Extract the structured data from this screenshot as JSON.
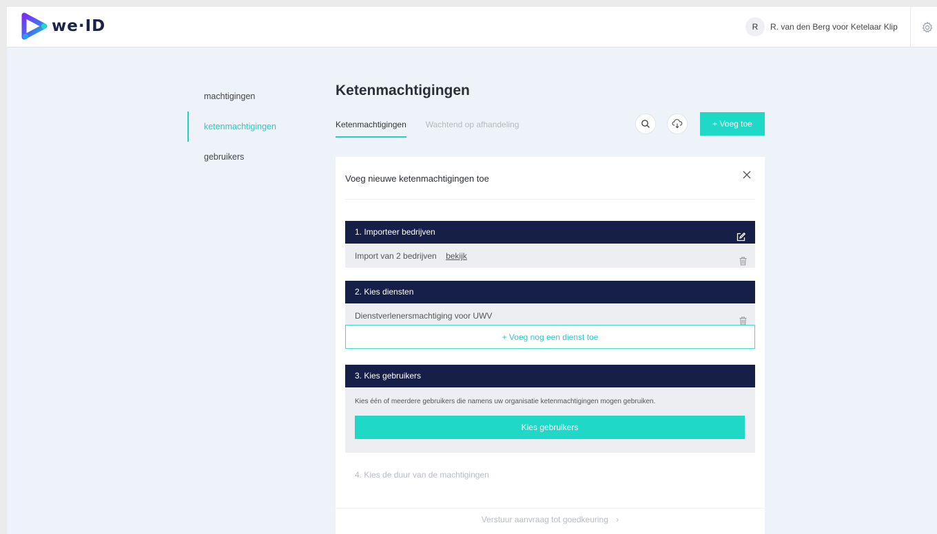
{
  "brand": {
    "logo_text": "we·ID"
  },
  "header": {
    "avatar_initial": "R",
    "user_name": "R. van den Berg voor Ketelaar Klip"
  },
  "sidebar": {
    "items": [
      {
        "label": "machtigingen"
      },
      {
        "label": "ketenmachtigingen",
        "active": true
      },
      {
        "label": "gebruikers"
      }
    ]
  },
  "main": {
    "title": "Ketenmachtigingen",
    "tabs": [
      {
        "label": "Ketenmachtigingen",
        "active": true
      },
      {
        "label": "Wachtend op afhandeling"
      }
    ],
    "add_button": "+ Voeg toe"
  },
  "card": {
    "title": "Voeg nieuwe ketenmachtigingen toe",
    "step1": {
      "header": "1. Importeer bedrijven",
      "row_text": "Import van 2 bedrijven",
      "row_link": "bekijk"
    },
    "step2": {
      "header": "2. Kies diensten",
      "row_text": "Dienstverlenersmachtiging voor UWV",
      "add_service": "+ Voeg nog een dienst toe"
    },
    "step3": {
      "header": "3. Kies gebruikers",
      "description": "Kies één of meerdere gebruikers die namens uw organisatie ketenmachtigingen mogen gebruiken.",
      "button": "Kies gebruikers"
    },
    "step4": {
      "label": "4. Kies de duur van de machtigingen"
    },
    "submit": "Verstuur aanvraag tot goedkeuring",
    "submit_arrow": "›"
  },
  "colors": {
    "accent": "#1fd8c5",
    "navy": "#161f48",
    "background": "#eef3fa"
  }
}
